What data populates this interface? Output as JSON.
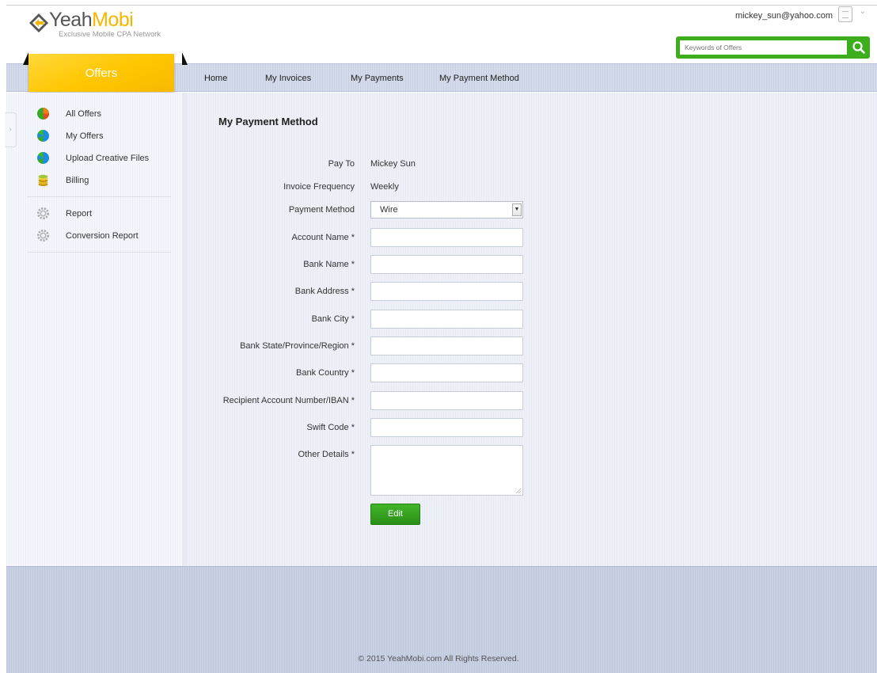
{
  "brand": {
    "name_part1": "Yeah",
    "name_part2": "Mobi",
    "tagline": "Exclusive Mobile CPA Network",
    "accent_yellow": "#f7b500",
    "accent_green": "#3cae1c"
  },
  "header": {
    "user_email": "mickey_sun@yahoo.com",
    "search_placeholder": "Keywords of Offers",
    "icons": [
      "document-icon",
      "chevron-down-icon",
      "search-icon"
    ]
  },
  "nav": {
    "active_tab": "Offers",
    "items": [
      {
        "label": "Home"
      },
      {
        "label": "My Invoices"
      },
      {
        "label": "My Payments"
      },
      {
        "label": "My Payment Method"
      }
    ]
  },
  "sidebar": {
    "groups": [
      [
        {
          "label": "All Offers",
          "icon": "pie-chart-icon"
        },
        {
          "label": "My Offers",
          "icon": "pie-chart-icon"
        },
        {
          "label": "Upload Creative Files",
          "icon": "pie-chart-icon"
        },
        {
          "label": "Billing",
          "icon": "coins-icon"
        }
      ],
      [
        {
          "label": "Report",
          "icon": "gear-icon"
        },
        {
          "label": "Conversion Report",
          "icon": "gear-icon"
        }
      ]
    ]
  },
  "main": {
    "title": "My Payment Method",
    "fields": {
      "pay_to": {
        "label": "Pay To",
        "value": "Mickey Sun"
      },
      "invoice_frequency": {
        "label": "Invoice Frequency",
        "value": "Weekly"
      },
      "payment_method": {
        "label": "Payment Method",
        "value": "Wire"
      },
      "account_name": {
        "label": "Account Name *",
        "value": ""
      },
      "bank_name": {
        "label": "Bank Name *",
        "value": ""
      },
      "bank_address": {
        "label": "Bank Address *",
        "value": ""
      },
      "bank_city": {
        "label": "Bank City *",
        "value": ""
      },
      "bank_state": {
        "label": "Bank State/Province/Region *",
        "value": ""
      },
      "bank_country": {
        "label": "Bank Country *",
        "value": ""
      },
      "recipient_account": {
        "label": "Recipient Account Number/IBAN *",
        "value": ""
      },
      "swift_code": {
        "label": "Swift Code *",
        "value": ""
      },
      "other_details": {
        "label": "Other Details *",
        "value": ""
      }
    },
    "edit_button": "Edit"
  },
  "footer": {
    "copyright": "© 2015 YeahMobi.com All Rights Reserved."
  }
}
